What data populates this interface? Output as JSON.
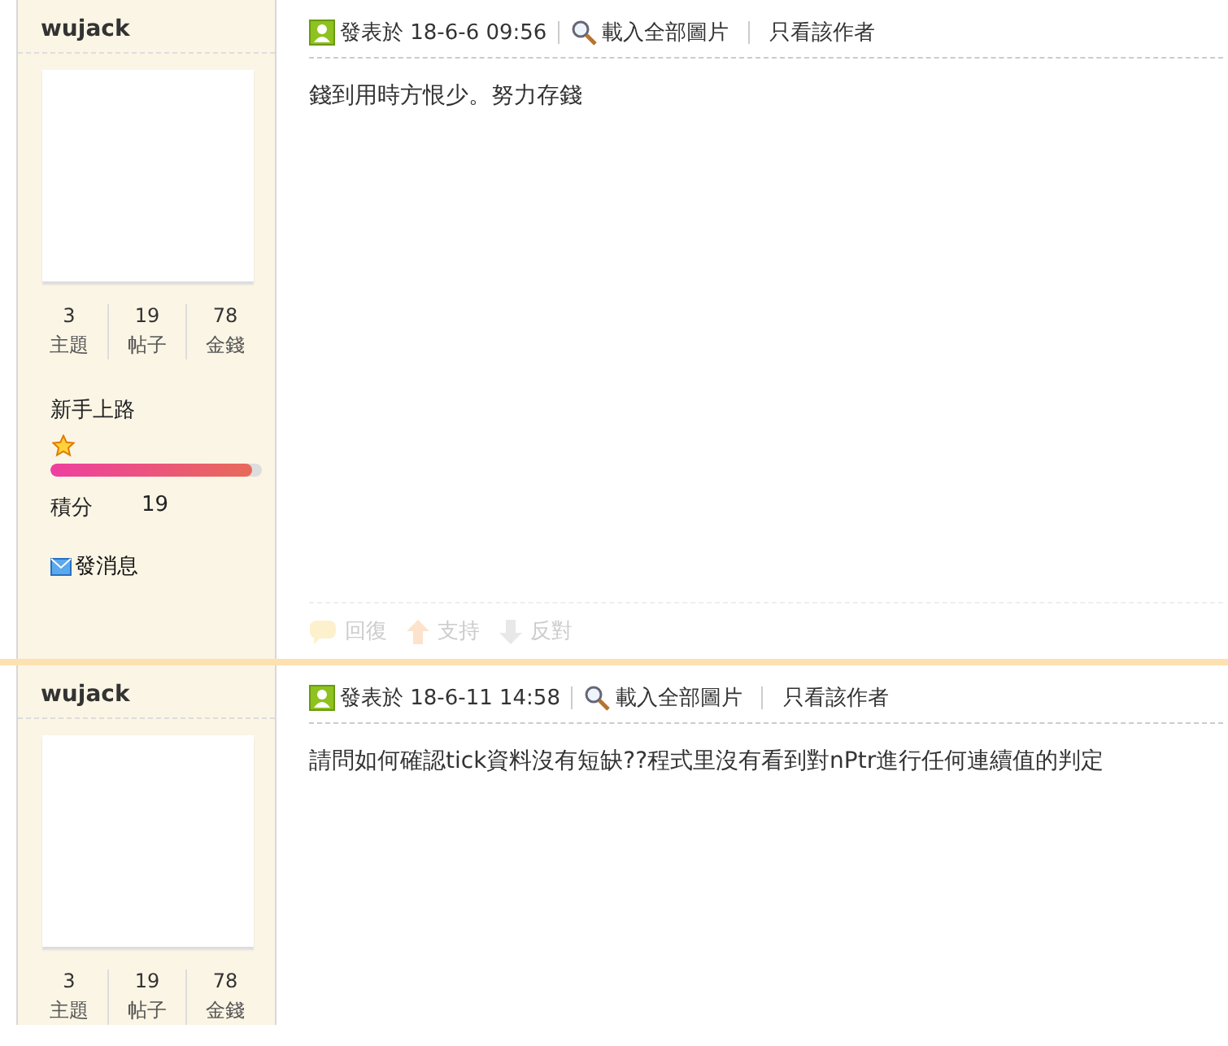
{
  "posts": [
    {
      "author": "wujack",
      "stats": [
        {
          "value": "3",
          "label": "主題"
        },
        {
          "value": "19",
          "label": "帖子"
        },
        {
          "value": "78",
          "label": "金錢"
        }
      ],
      "rank": "新手上路",
      "progress": {
        "level": 0.95
      },
      "points": {
        "label": "積分",
        "value": "19"
      },
      "message": "發消息",
      "posted": "發表於 18-6-6 09:56",
      "load_images": "載入全部圖片",
      "only_author": "只看該作者",
      "body": "錢到用時方恨少。努力存錢",
      "actions": [
        {
          "kind": "reply",
          "label": "回復",
          "disabled": true
        },
        {
          "kind": "up",
          "label": "支持",
          "disabled": true
        },
        {
          "kind": "down",
          "label": "反對",
          "disabled": true
        }
      ]
    },
    {
      "author": "wujack",
      "stats": [
        {
          "value": "3",
          "label": "主題"
        },
        {
          "value": "19",
          "label": "帖子"
        },
        {
          "value": "78",
          "label": "金錢"
        }
      ],
      "posted": "發表於 18-6-11 14:58",
      "load_images": "載入全部圖片",
      "only_author": "只看該作者",
      "body": "請問如何確認tick資料沒有短缺??程式里沒有看到對nPtr進行任何連續值的判定"
    }
  ]
}
